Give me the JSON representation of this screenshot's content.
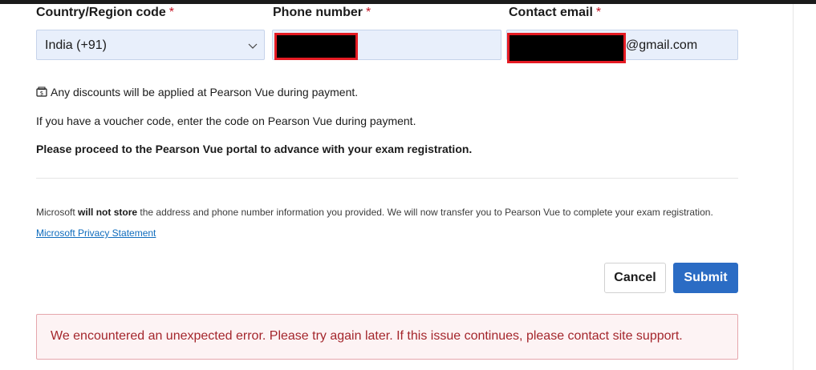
{
  "form": {
    "country": {
      "label": "Country/Region code",
      "required_mark": "*",
      "value": "India (+91)"
    },
    "phone": {
      "label": "Phone number",
      "required_mark": "*"
    },
    "email": {
      "label": "Contact email",
      "required_mark": "*",
      "suffix": "@gmail.com"
    }
  },
  "notes": {
    "discount": "Any discounts will be applied at Pearson Vue during payment.",
    "voucher": "If you have a voucher code, enter the code on Pearson Vue during payment.",
    "proceed": "Please proceed to the Pearson Vue portal to advance with your exam registration."
  },
  "privacy": {
    "prefix": "Microsoft",
    "emphasis": "will not store",
    "text": "the address and phone number information you provided. We will now transfer you to Pearson Vue to complete your exam registration.",
    "link": "Microsoft Privacy Statement"
  },
  "actions": {
    "cancel": "Cancel",
    "submit": "Submit"
  },
  "error": {
    "message": "We encountered an unexpected error. Please try again later. If this issue continues, please contact site support."
  },
  "colors": {
    "accent": "#2b6cc4",
    "required": "#c50f1f",
    "error_text": "#a4262c",
    "redaction_border": "#e51b23"
  }
}
